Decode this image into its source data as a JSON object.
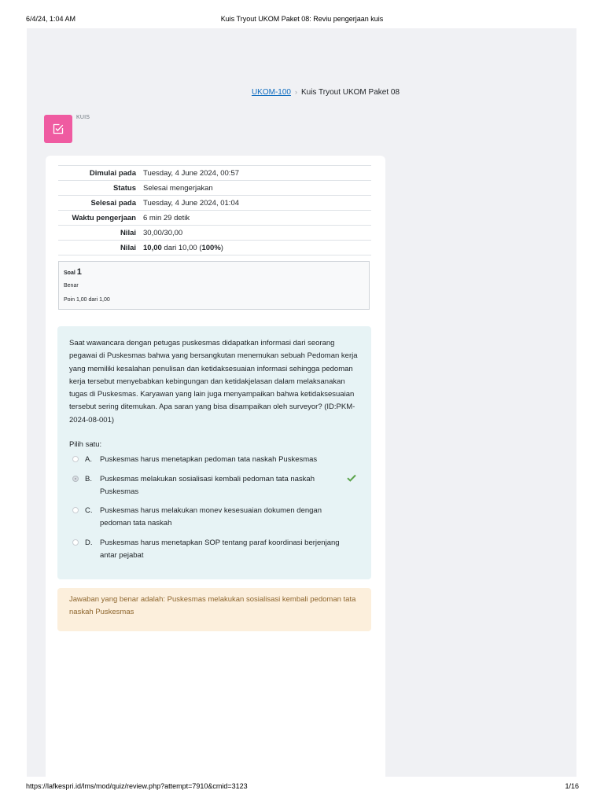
{
  "print_header": {
    "date": "6/4/24, 1:04 AM",
    "title": "Kuis Tryout UKOM Paket 08: Reviu pengerjaan kuis"
  },
  "breadcrumb": {
    "course": "UKOM-100",
    "separator": "›",
    "current": "Kuis Tryout UKOM Paket 08"
  },
  "module": {
    "label": "KUIS",
    "icon": "quiz-icon",
    "icon_color": "#ef5ba1"
  },
  "summary": [
    {
      "label": "Dimulai pada",
      "value": "Tuesday, 4 June 2024, 00:57"
    },
    {
      "label": "Status",
      "value": "Selesai mengerjakan"
    },
    {
      "label": "Selesai pada",
      "value": "Tuesday, 4 June 2024, 01:04"
    },
    {
      "label": "Waktu pengerjaan",
      "value": "6 min 29 detik"
    },
    {
      "label": "Nilai",
      "value": "30,00/30,00"
    },
    {
      "label": "Nilai",
      "value_bold": "10,00",
      "value_mid": " dari 10,00 (",
      "value_pct": "100%",
      "value_end": ")"
    }
  ],
  "question": {
    "label": "Soal",
    "number": "1",
    "state": "Benar",
    "grade": "Poin 1,00 dari 1,00",
    "text": "Saat wawancara dengan petugas puskesmas didapatkan informasi dari seorang pegawai di Puskesmas bahwa yang bersangkutan menemukan sebuah Pedoman kerja yang memiliki kesalahan penulisan dan ketidaksesuaian informasi sehingga pedoman kerja tersebut menyebabkan kebingungan dan ketidakjelasan dalam melaksanakan tugas di Puskesmas. Karyawan yang lain juga menyampaikan bahwa ketidaksesuaian tersebut sering ditemukan. Apa saran yang bisa disampaikan oleh surveyor? (ID:PKM-2024-08-001)",
    "prompt": "Pilih satu:",
    "answers": [
      {
        "letter": "A.",
        "text": "Puskesmas harus menetapkan pedoman tata naskah Puskesmas",
        "selected": false
      },
      {
        "letter": "B.",
        "text": "Puskesmas melakukan sosialisasi kembali pedoman tata naskah Puskesmas",
        "selected": true
      },
      {
        "letter": "C.",
        "text": "Puskesmas harus melakukan monev kesesuaian dokumen dengan pedoman tata naskah",
        "selected": false
      },
      {
        "letter": "D.",
        "text": "Puskesmas harus menetapkan SOP tentang paraf koordinasi berjenjang antar pejabat",
        "selected": false
      }
    ],
    "correct_icon": "check-icon",
    "correct_color": "#5aa34a",
    "feedback": "Jawaban yang benar adalah: Puskesmas melakukan sosialisasi kembali pedoman tata naskah Puskesmas"
  },
  "print_footer": {
    "url": "https://lafkespri.id/lms/mod/quiz/review.php?attempt=7910&cmid=3123",
    "page": "1/16"
  }
}
